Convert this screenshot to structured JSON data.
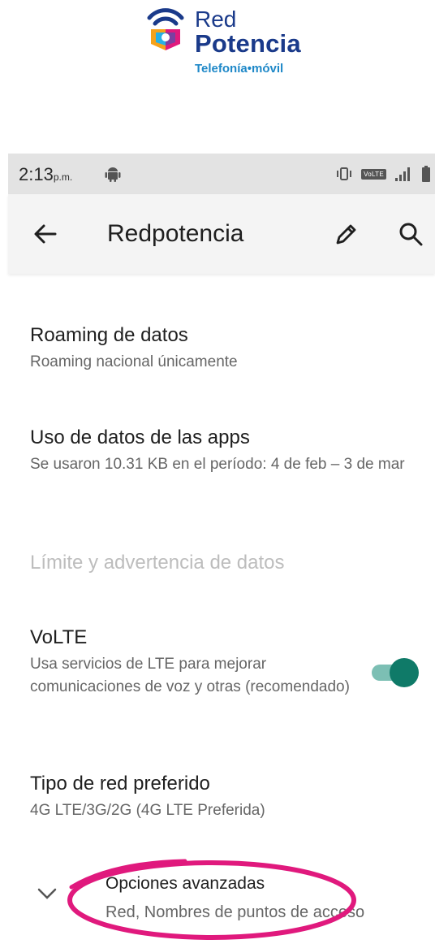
{
  "brand": {
    "line1": "Red",
    "line2": "Potencia",
    "tagline": "Telefonía•móvil",
    "colors": {
      "navy": "#1a3a8a",
      "blue": "#1e88c8"
    }
  },
  "status_bar": {
    "time": "2:13",
    "time_suffix": "p.m.",
    "network_badge": "VoLTE",
    "icons": [
      "android-icon",
      "vibrate-icon",
      "signal-icon",
      "battery-icon"
    ]
  },
  "app_bar": {
    "title": "Redpotencia",
    "icons": [
      "back-arrow-icon",
      "pencil-icon",
      "search-icon"
    ]
  },
  "settings": {
    "roaming": {
      "title": "Roaming de datos",
      "subtitle": "Roaming nacional únicamente"
    },
    "app_data": {
      "title": "Uso de datos de las apps",
      "subtitle": "Se usaron 10.31 KB en el período: 4 de feb – 3 de mar"
    },
    "limit": {
      "title": "Límite y advertencia de datos"
    },
    "volte": {
      "title": "VoLTE",
      "subtitle": "Usa servicios de LTE para mejorar comunicaciones de voz y otras (recomendado)",
      "enabled": true
    },
    "network_type": {
      "title": "Tipo de red preferido",
      "subtitle": "4G LTE/3G/2G (4G LTE Preferida)"
    },
    "advanced": {
      "title": "Opciones avanzadas",
      "subtitle": "Red, Nombres de puntos de acceso"
    }
  },
  "colors": {
    "toggle_on": "#0f7a68",
    "toggle_track": "#7cbfb4",
    "highlight": "#e0197d"
  }
}
